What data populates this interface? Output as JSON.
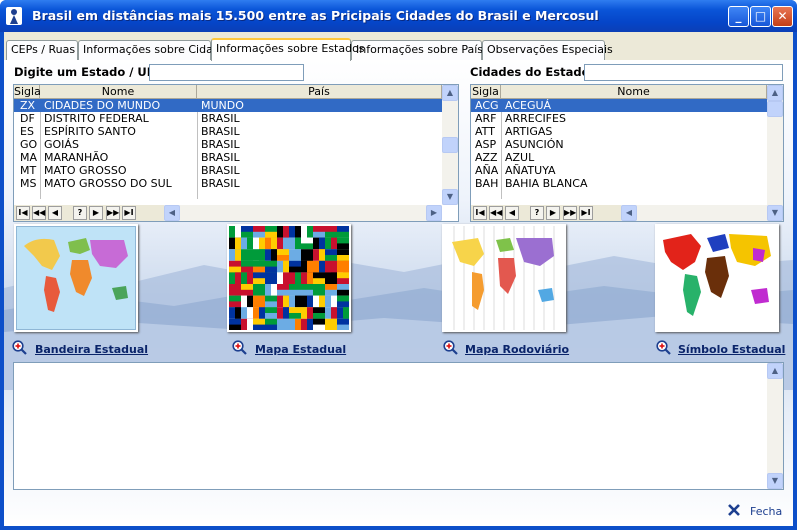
{
  "window": {
    "title": "Brasil em  distâncias mais 15.500 entre as Pricipais Cidades do Brasil e Mercosul"
  },
  "tabs": [
    "CEPs / Ruas",
    "Informações sobre Cidade",
    "Informações sobre Estados",
    "Informações sobre Países",
    "Observações Especiais"
  ],
  "active_tab": "Informações sobre Estados",
  "left": {
    "label": "Digite um Estado / UF:",
    "input_value": "",
    "columns": [
      "Sigla",
      "Nome",
      "País"
    ],
    "rows": [
      [
        "ZX",
        "CIDADES DO MUNDO",
        "MUNDO"
      ],
      [
        "DF",
        "DISTRITO FEDERAL",
        "BRASIL"
      ],
      [
        "ES",
        "ESPÍRITO SANTO",
        "BRASIL"
      ],
      [
        "GO",
        "GOIÁS",
        "BRASIL"
      ],
      [
        "MA",
        "MARANHÃO",
        "BRASIL"
      ],
      [
        "MT",
        "MATO GROSSO",
        "BRASIL"
      ],
      [
        "MS",
        "MATO GROSSO DO SUL",
        "BRASIL"
      ]
    ]
  },
  "right": {
    "label": "Cidades do Estado:",
    "input_value": "",
    "columns": [
      "Sigla",
      "Nome"
    ],
    "rows": [
      [
        "ACG",
        "ACEGUÁ"
      ],
      [
        "ARF",
        "ARRECIFES"
      ],
      [
        "ATT",
        "ARTIGAS"
      ],
      [
        "ASP",
        "ASUNCIÓN"
      ],
      [
        "AZZ",
        "AZUL"
      ],
      [
        "AÑA",
        "AÑATUYA"
      ],
      [
        "BAH",
        "BAHIA BLANCA"
      ]
    ]
  },
  "navigator": [
    "I◀",
    "◀◀",
    "◀",
    "?",
    "▶",
    "▶▶",
    "▶I"
  ],
  "pictures": [
    {
      "link": "Bandeira Estadual",
      "icon": "world-map-image"
    },
    {
      "link": "Mapa Estadual",
      "icon": "flags-image"
    },
    {
      "link": "Mapa Rodoviário",
      "icon": "timezone-map-image"
    },
    {
      "link": "Símbolo Estadual",
      "icon": "continents-map-image"
    }
  ],
  "memo_text": "",
  "footer": {
    "close_label": "Fecha"
  },
  "colors": {
    "selection": "#316ac5",
    "titlebar": "#0a55d8",
    "tab_highlight": "#ffc83c"
  }
}
